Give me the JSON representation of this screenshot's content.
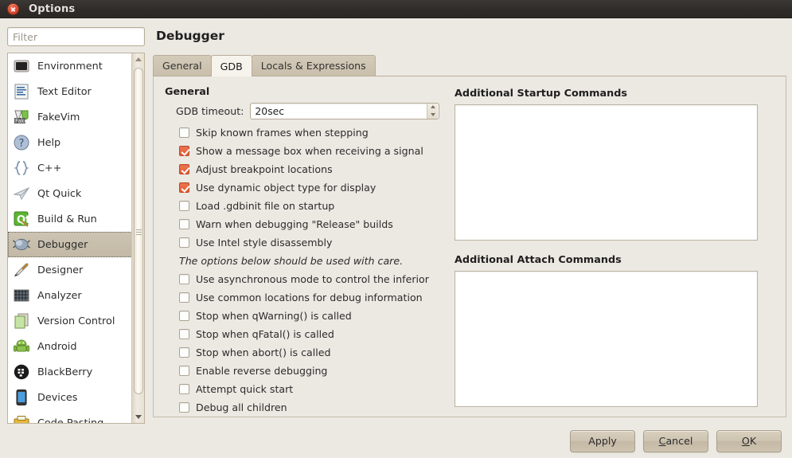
{
  "window": {
    "title": "Options",
    "close_icon": "close-icon"
  },
  "sidebar": {
    "filter": {
      "value": "",
      "placeholder": "Filter"
    },
    "items": [
      {
        "label": "Environment",
        "icon": "monitor-icon",
        "selected": false
      },
      {
        "label": "Text Editor",
        "icon": "document-text-icon",
        "selected": false
      },
      {
        "label": "FakeVim",
        "icon": "fakevim-icon",
        "selected": false
      },
      {
        "label": "Help",
        "icon": "question-mark-icon",
        "selected": false
      },
      {
        "label": "C++",
        "icon": "braces-icon",
        "selected": false
      },
      {
        "label": "Qt Quick",
        "icon": "paper-plane-icon",
        "selected": false
      },
      {
        "label": "Build & Run",
        "icon": "qt-hammer-icon",
        "selected": false
      },
      {
        "label": "Debugger",
        "icon": "bug-icon",
        "selected": true
      },
      {
        "label": "Designer",
        "icon": "pen-ruler-icon",
        "selected": false
      },
      {
        "label": "Analyzer",
        "icon": "grid-chart-icon",
        "selected": false
      },
      {
        "label": "Version Control",
        "icon": "copy-pages-icon",
        "selected": false
      },
      {
        "label": "Android",
        "icon": "android-robot-icon",
        "selected": false
      },
      {
        "label": "BlackBerry",
        "icon": "blackberry-icon",
        "selected": false
      },
      {
        "label": "Devices",
        "icon": "phone-device-icon",
        "selected": false
      },
      {
        "label": "Code Pasting",
        "icon": "clipboard-icon",
        "selected": false
      }
    ],
    "scrollbar": {
      "up_arrow": "triangle-up-icon",
      "down_arrow": "triangle-down-icon"
    }
  },
  "main": {
    "page_title": "Debugger",
    "tabs": [
      {
        "label": "General",
        "active": false
      },
      {
        "label": "GDB",
        "active": true
      },
      {
        "label": "Locals & Expressions",
        "active": false
      }
    ],
    "general_group_label": "General",
    "timeout": {
      "label": "GDB timeout:",
      "value": "20sec",
      "spin_up_icon": "spinner-up-icon",
      "spin_down_icon": "spinner-down-icon"
    },
    "options": [
      {
        "label": "Skip known frames when stepping",
        "checked": false
      },
      {
        "label": "Show a message box when receiving a signal",
        "checked": true
      },
      {
        "label": "Adjust breakpoint locations",
        "checked": true
      },
      {
        "label": "Use dynamic object type for display",
        "checked": true
      },
      {
        "label": "Load .gdbinit file on startup",
        "checked": false
      },
      {
        "label": "Warn when debugging \"Release\" builds",
        "checked": false
      },
      {
        "label": "Use Intel style disassembly",
        "checked": false
      }
    ],
    "care_note": "The options below should be used with care.",
    "advanced_options": [
      {
        "label": "Use asynchronous mode to control the inferior",
        "checked": false
      },
      {
        "label": "Use common locations for debug information",
        "checked": false
      },
      {
        "label": "Stop when qWarning() is called",
        "checked": false
      },
      {
        "label": "Stop when qFatal() is called",
        "checked": false
      },
      {
        "label": "Stop when abort() is called",
        "checked": false
      },
      {
        "label": "Enable reverse debugging",
        "checked": false
      },
      {
        "label": "Attempt quick start",
        "checked": false
      },
      {
        "label": "Debug all children",
        "checked": false
      }
    ],
    "startup_commands": {
      "label": "Additional Startup Commands",
      "value": ""
    },
    "attach_commands": {
      "label": "Additional Attach Commands",
      "value": ""
    }
  },
  "buttons": {
    "apply": "Apply",
    "cancel_prefix": "",
    "cancel_accel": "C",
    "cancel_suffix": "ancel",
    "ok_accel": "O",
    "ok_suffix": "K"
  },
  "colors": {
    "accent": "#e25c33",
    "window_bg": "#ece9e3",
    "titlebar": "#302c29",
    "selection": "#c6bca9"
  }
}
